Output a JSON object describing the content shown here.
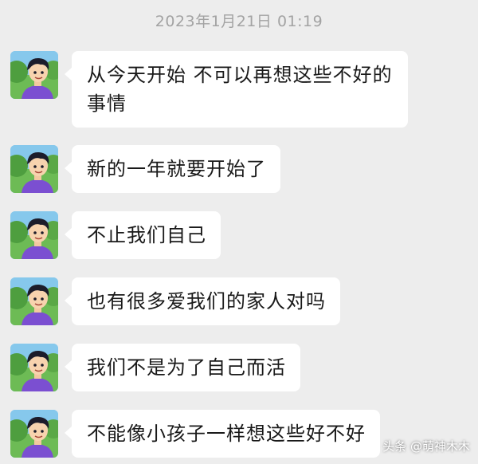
{
  "timestamp": "2023年1月21日 01:19",
  "messages": [
    {
      "text": "从今天开始 不可以再想这些不好的事情"
    },
    {
      "text": "新的一年就要开始了"
    },
    {
      "text": "不止我们自己"
    },
    {
      "text": "也有很多爱我们的家人对吗"
    },
    {
      "text": "我们不是为了自己而活"
    },
    {
      "text": "不能像小孩子一样想这些好不好"
    }
  ],
  "watermark": "头条 @萌神木木",
  "colors": {
    "background": "#ededed",
    "bubble": "#ffffff",
    "text": "#191919",
    "timestamp": "#a3a3a3"
  }
}
